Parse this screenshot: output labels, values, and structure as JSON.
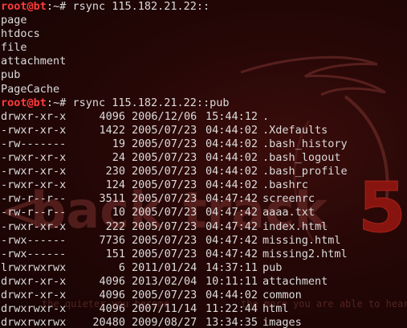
{
  "prompt": {
    "user": "root",
    "at": "@",
    "host": "bt",
    "path": ":~#"
  },
  "commands": [
    "rsync 115.182.21.22::",
    "rsync 115.182.21.22::pub"
  ],
  "modules": [
    "page",
    "htdocs",
    "file",
    "attachment",
    "pub",
    "PageCache"
  ],
  "listing": [
    {
      "perm": "drwxr-xr-x",
      "size": "4096",
      "date": "2006/12/06",
      "time": "15:44:12",
      "name": "."
    },
    {
      "perm": "-rwxr-xr-x",
      "size": "1422",
      "date": "2005/07/23",
      "time": "04:44:02",
      "name": ".Xdefaults"
    },
    {
      "perm": "-rw-------",
      "size": "19",
      "date": "2005/07/23",
      "time": "04:44:02",
      "name": ".bash_history"
    },
    {
      "perm": "-rwxr-xr-x",
      "size": "24",
      "date": "2005/07/23",
      "time": "04:44:02",
      "name": ".bash_logout"
    },
    {
      "perm": "-rwxr-xr-x",
      "size": "230",
      "date": "2005/07/23",
      "time": "04:44:02",
      "name": ".bash_profile"
    },
    {
      "perm": "-rwxr-xr-x",
      "size": "124",
      "date": "2005/07/23",
      "time": "04:44:02",
      "name": ".bashrc"
    },
    {
      "perm": "-rw-r--r--",
      "size": "3511",
      "date": "2005/07/23",
      "time": "04:47:42",
      "name": "screenrc"
    },
    {
      "perm": "-rw-r--r--",
      "size": "10",
      "date": "2005/07/23",
      "time": "04:47:42",
      "name": "aaaa.txt"
    },
    {
      "perm": "-rwxr-xr-x",
      "size": "222",
      "date": "2005/07/23",
      "time": "04:47:42",
      "name": "index.html"
    },
    {
      "perm": "-rwx------",
      "size": "7736",
      "date": "2005/07/23",
      "time": "04:47:42",
      "name": "missing.html"
    },
    {
      "perm": "-rwx------",
      "size": "151",
      "date": "2005/07/23",
      "time": "04:47:42",
      "name": "missing2.html"
    },
    {
      "perm": "lrwxrwxrwx",
      "size": "6",
      "date": "2011/01/24",
      "time": "14:37:11",
      "name": "pub"
    },
    {
      "perm": "drwxr-xr-x",
      "size": "4096",
      "date": "2013/02/04",
      "time": "10:11:11",
      "name": "attachment"
    },
    {
      "perm": "drwxr-xr-x",
      "size": "4096",
      "date": "2005/07/23",
      "time": "04:44:02",
      "name": "common"
    },
    {
      "perm": "drwxrwxr-x",
      "size": "4096",
      "date": "2007/11/14",
      "time": "11:22:44",
      "name": "html"
    },
    {
      "perm": "drwxrwxrwx",
      "size": "20480",
      "date": "2009/08/27",
      "time": "13:34:35",
      "name": "images"
    }
  ],
  "wallpaper": {
    "brand_left": "<",
    "brand_text": "back",
    "brand_text2": "track",
    "brand_num": "5",
    "tagline_left": "the quieter you become",
    "tagline_right": "the more you are able to hear",
    "colors": {
      "background": "#250706",
      "watermark": "#5a1f1c",
      "accent": "#c0180f"
    }
  },
  "colors": {
    "prompt": "#ff3b3b",
    "text": "#dcdcdc"
  }
}
